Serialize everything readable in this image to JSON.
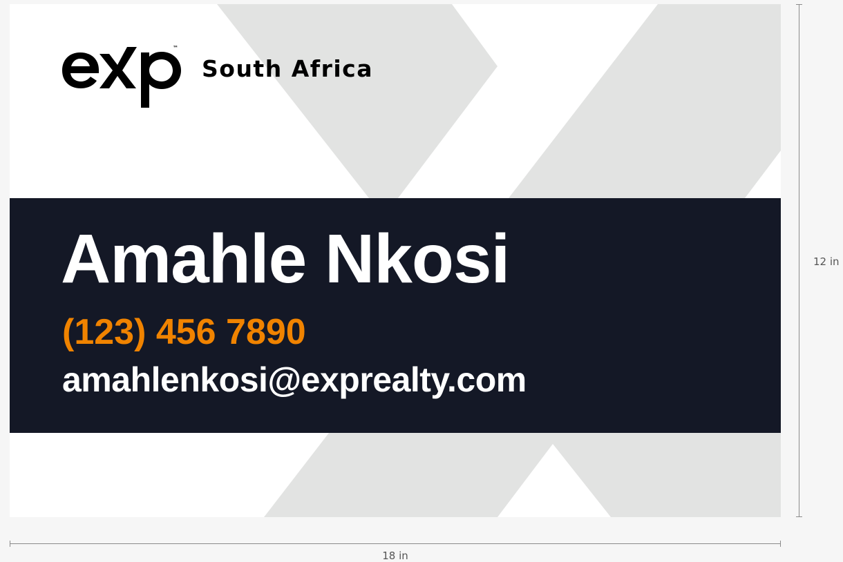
{
  "sign": {
    "brand_region": "South Africa",
    "agent_name": "Amahle Nkosi",
    "phone": "(123) 456 7890",
    "email": "amahlenkosi@exprealty.com"
  },
  "logo": {
    "icon": "exp-logo",
    "text": "eXp",
    "trademark": "™"
  },
  "dimensions": {
    "width_label": "18 in",
    "height_label": "12 in"
  },
  "colors": {
    "band": "#141826",
    "phone": "#f08300",
    "name": "#ffffff",
    "shape": "#e2e3e2",
    "background": "#f6f6f6"
  }
}
